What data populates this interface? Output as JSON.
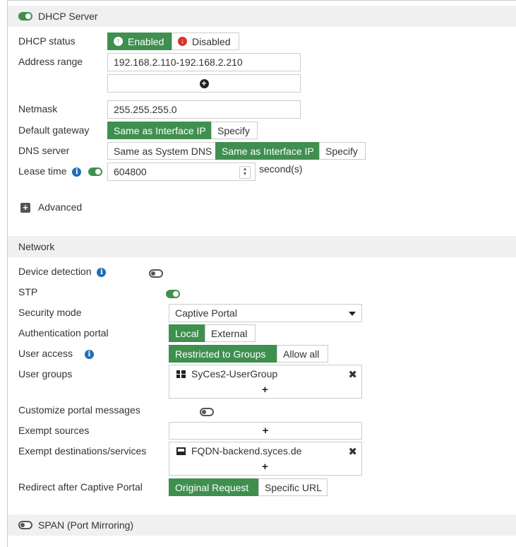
{
  "dhcp": {
    "title": "DHCP Server",
    "status_label": "DHCP status",
    "status_enabled": "Enabled",
    "status_disabled": "Disabled",
    "address_range_label": "Address range",
    "address_range_value": "192.168.2.110-192.168.2.210",
    "netmask_label": "Netmask",
    "netmask_value": "255.255.255.0",
    "gateway_label": "Default gateway",
    "gateway_opt1": "Same as Interface IP",
    "gateway_opt2": "Specify",
    "dns_label": "DNS server",
    "dns_opt1": "Same as System DNS",
    "dns_opt2": "Same as Interface IP",
    "dns_opt3": "Specify",
    "lease_label": "Lease time",
    "lease_value": "604800",
    "lease_unit": "second(s)",
    "advanced_label": "Advanced"
  },
  "network": {
    "title": "Network",
    "device_detection_label": "Device detection",
    "stp_label": "STP",
    "security_mode_label": "Security mode",
    "security_mode_value": "Captive Portal",
    "auth_portal_label": "Authentication portal",
    "auth_portal_opt1": "Local",
    "auth_portal_opt2": "External",
    "user_access_label": "User access",
    "user_access_opt1": "Restricted to Groups",
    "user_access_opt2": "Allow all",
    "user_groups_label": "User groups",
    "user_groups_item": "SyCes2-UserGroup",
    "customize_label": "Customize portal messages",
    "exempt_sources_label": "Exempt sources",
    "exempt_dest_label": "Exempt destinations/services",
    "exempt_dest_item": "FQDN-backend.syces.de",
    "redirect_label": "Redirect after Captive Portal",
    "redirect_opt1": "Original Request",
    "redirect_opt2": "Specific URL"
  },
  "span": {
    "title": "SPAN (Port Mirroring)"
  },
  "icons": {
    "add": "plus-circle-icon",
    "remove": "close-x-icon",
    "info": "info-icon",
    "group": "user-group-icon",
    "fqdn": "fqdn-address-icon"
  },
  "colors": {
    "accent": "#3f8f4f",
    "info": "#1f6fb5",
    "disabled_red": "#d9342b"
  }
}
